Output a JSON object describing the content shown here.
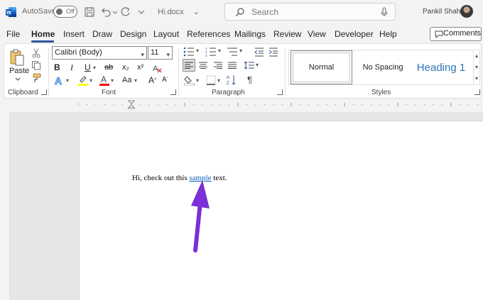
{
  "titlebar": {
    "autosave_label": "AutoSave",
    "autosave_state": "Off",
    "document_name": "Hi.docx",
    "document_dropdown": "⌄",
    "search_placeholder": "Search",
    "user_name": "Pankil Shah"
  },
  "menu": {
    "tabs": [
      "File",
      "Home",
      "Insert",
      "Draw",
      "Design",
      "Layout",
      "References",
      "Mailings",
      "Review",
      "View",
      "Developer",
      "Help"
    ],
    "active_tab": "Home",
    "comments_label": "Comments"
  },
  "ribbon": {
    "clipboard": {
      "paste_label": "Paste",
      "group_label": "Clipboard"
    },
    "font": {
      "font_name": "Calibri (Body)",
      "font_size": "11",
      "grow_font": "A^",
      "shrink_font": "A",
      "bold": "B",
      "italic": "I",
      "underline": "U",
      "strikethrough": "ab",
      "subscript": "x₂",
      "superscript": "x²",
      "change_case": "Aa",
      "group_label": "Font"
    },
    "paragraph": {
      "pilcrow": "¶",
      "group_label": "Paragraph"
    },
    "styles": {
      "items": [
        "Normal",
        "No Spacing",
        "Heading 1"
      ],
      "group_label": "Styles"
    }
  },
  "document": {
    "text_before": "Hi, check out this ",
    "link_text": "sample",
    "text_after": " text."
  },
  "colors": {
    "accent": "#2b579a",
    "heading": "#2e74b5",
    "link": "#0563c1",
    "arrow": "#7b2fd6",
    "highlight": "#ffff00",
    "font_color": "#ff0000"
  }
}
